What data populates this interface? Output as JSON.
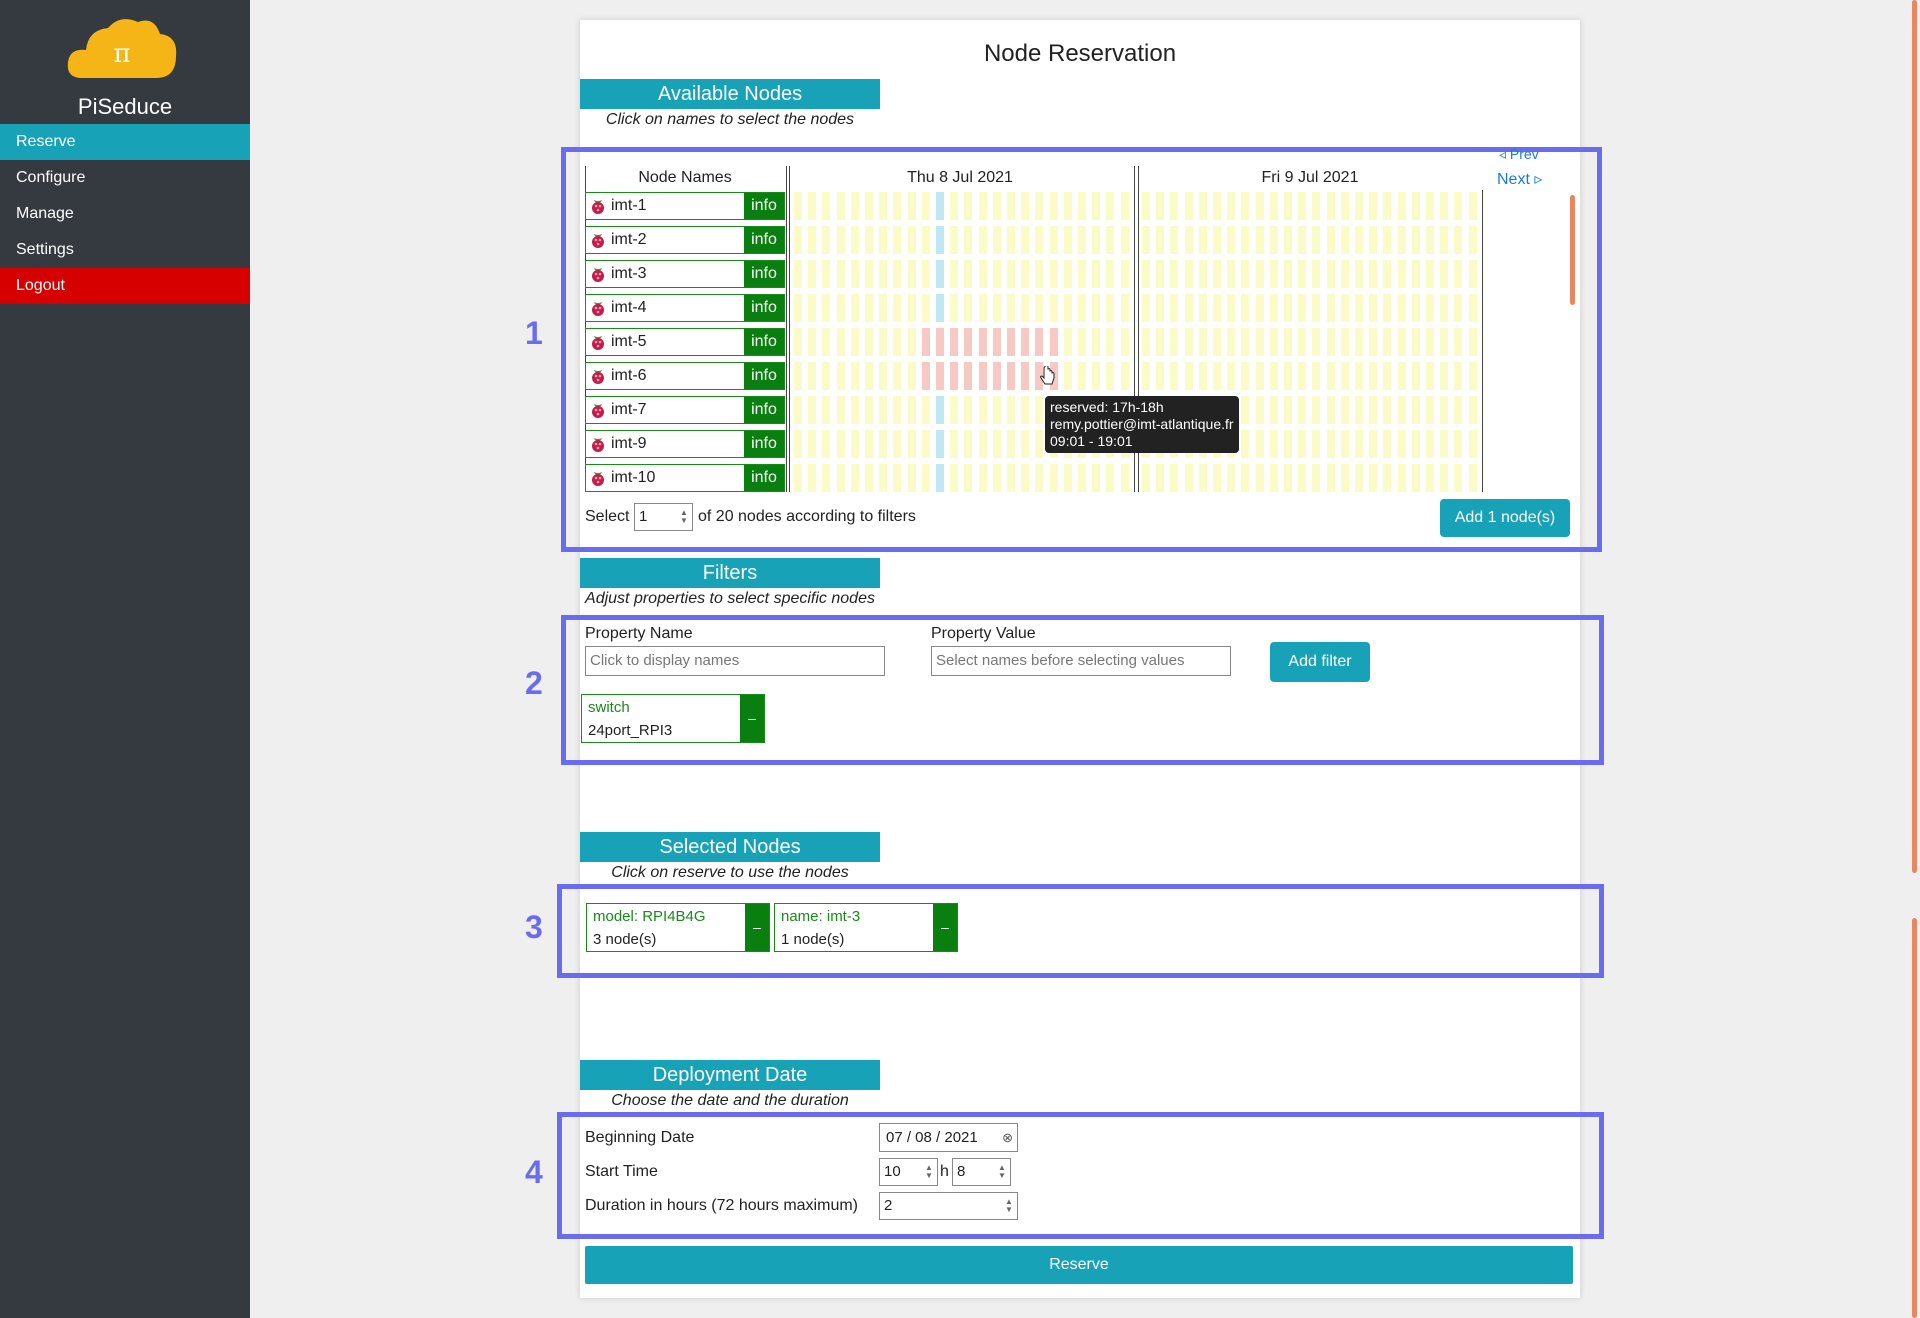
{
  "sidebar": {
    "brand": "PiSeduce",
    "items": [
      {
        "label": "Reserve",
        "color": "#17a2b8"
      },
      {
        "label": "Configure",
        "color": ""
      },
      {
        "label": "Manage",
        "color": ""
      },
      {
        "label": "Settings",
        "color": ""
      },
      {
        "label": "Logout",
        "color": "#d60000"
      }
    ]
  },
  "page_title": "Node Reservation",
  "available": {
    "header": "Available Nodes",
    "subtitle": "Click on names to select the nodes",
    "col_names": "Node Names",
    "day1": "Thu 8 Jul 2021",
    "day2": "Fri 9 Jul 2021",
    "prev": "◃ Prev",
    "next": "Next ▹",
    "info_label": "info",
    "nodes": [
      "imt-1",
      "imt-2",
      "imt-3",
      "imt-4",
      "imt-5",
      "imt-6",
      "imt-7",
      "imt-9",
      "imt-10"
    ],
    "select_prefix": "Select",
    "select_value": "1",
    "select_suffix": "of 20 nodes according to filters",
    "add_button": "Add 1 node(s)"
  },
  "tooltip": {
    "line1": "reserved: 17h-18h",
    "line2": "remy.pottier@imt-atlantique.fr",
    "line3": "09:01 - 19:01"
  },
  "filters": {
    "header": "Filters",
    "subtitle": "Adjust properties to select specific nodes",
    "prop_name_label": "Property Name",
    "prop_name_placeholder": "Click to display names",
    "prop_value_label": "Property Value",
    "prop_value_placeholder": "Select names before selecting values",
    "add_button": "Add filter",
    "chip_key": "switch",
    "chip_value": "24port_RPI3",
    "chip_remove": "–"
  },
  "selected": {
    "header": "Selected Nodes",
    "subtitle": "Click on reserve to use the nodes",
    "chips": [
      {
        "key": "model: RPI4B4G",
        "value": "3 node(s)"
      },
      {
        "key": "name: imt-3",
        "value": "1 node(s)"
      }
    ],
    "remove": "–"
  },
  "deployment": {
    "header": "Deployment Date",
    "subtitle": "Choose the date and the duration",
    "begin_label": "Beginning Date",
    "begin_value": "07 / 08 / 2021",
    "start_label": "Start Time",
    "start_hour": "10",
    "h": "h",
    "start_min": "8",
    "duration_label": "Duration in hours (72 hours maximum)",
    "duration_value": "2",
    "reserve_button": "Reserve"
  },
  "annotations": [
    "1",
    "2",
    "3",
    "4"
  ],
  "colors": {
    "free_cell": "#fbfbc8",
    "now_cell": "#bfe8f3",
    "reserved_cell": "#f6c9c4",
    "accent": "#17a2b8",
    "annot": "#6a6cf0"
  }
}
